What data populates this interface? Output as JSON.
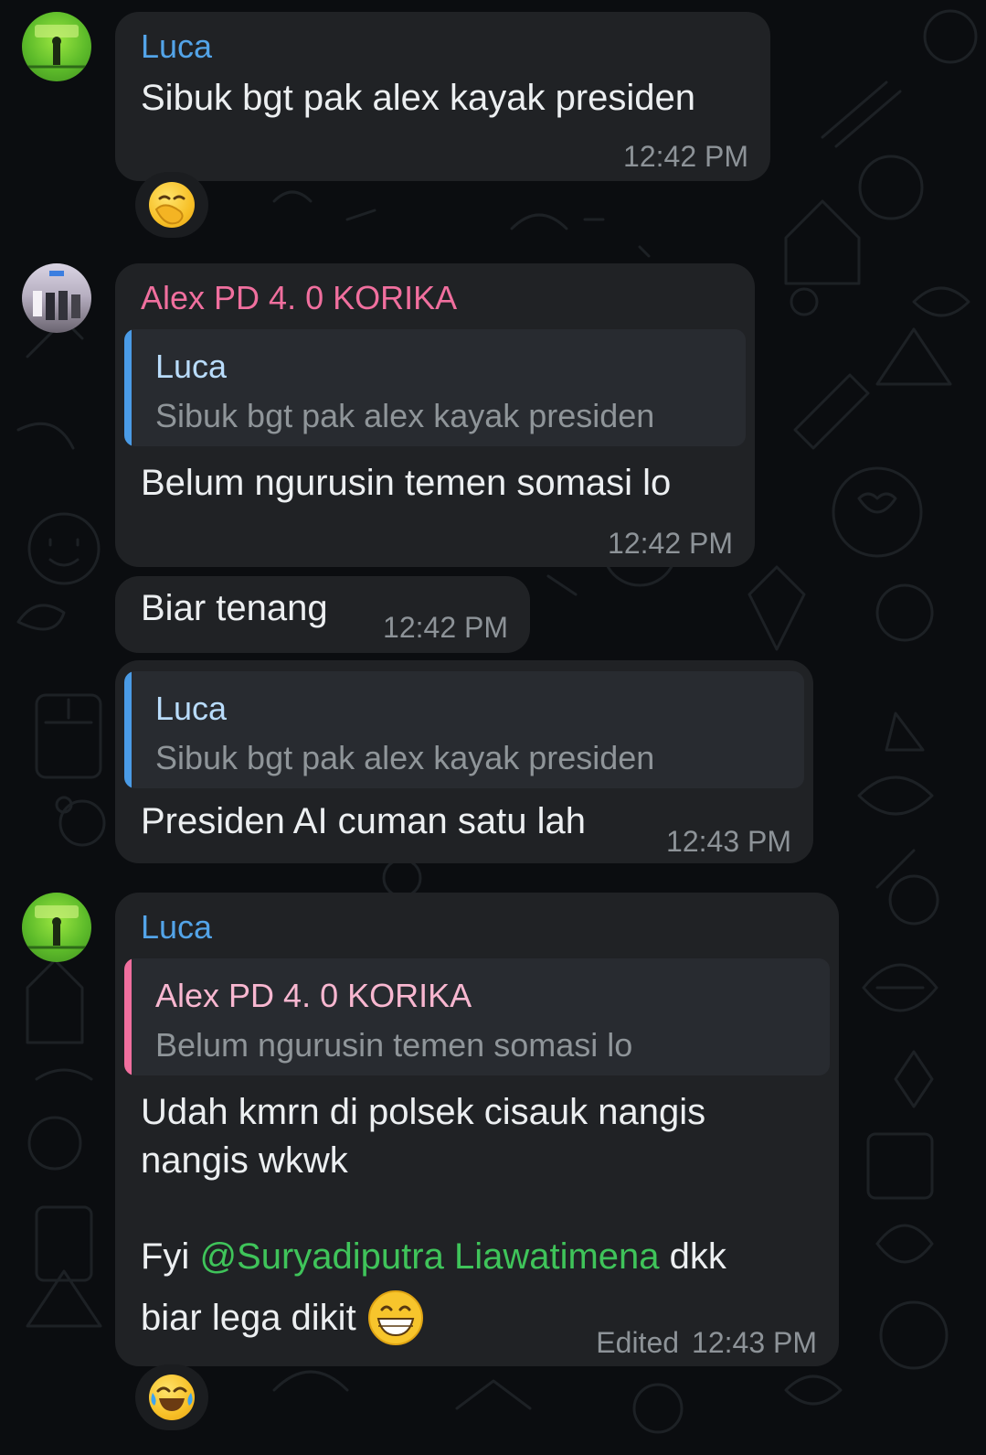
{
  "messages": [
    {
      "sender": "Luca",
      "text": "Sibuk bgt pak alex kayak presiden",
      "time": "12:42 PM",
      "reaction": "face-with-hand-over-mouth-emoji"
    },
    {
      "sender": "Alex PD 4. 0 KORIKA",
      "reply_to": {
        "sender": "Luca",
        "text": "Sibuk bgt pak alex kayak presiden"
      },
      "text": "Belum ngurusin temen somasi lo",
      "time": "12:42 PM"
    },
    {
      "text": "Biar tenang",
      "time": "12:42 PM"
    },
    {
      "reply_to": {
        "sender": "Luca",
        "text": "Sibuk bgt pak alex kayak presiden"
      },
      "text": "Presiden AI cuman satu lah",
      "time": "12:43 PM"
    },
    {
      "sender": "Luca",
      "reply_to": {
        "sender": "Alex PD 4. 0 KORIKA",
        "text": "Belum ngurusin temen somasi lo"
      },
      "text_line1": "Udah kmrn di polsek cisauk nangis",
      "text_line2": "nangis wkwk",
      "text_fyi": "Fyi",
      "mention": "@Suryadiputra Liawatimena",
      "text_after_mention": "dkk",
      "text_line4": "biar lega dikit",
      "inline_emoji": "grinning-face-emoji",
      "edited": "Edited",
      "time": "12:43 PM",
      "reaction": "face-with-tears-of-joy-emoji"
    }
  ],
  "colors": {
    "background": "#0b0d10",
    "bubble": "#202225",
    "quote_bg": "#282b30",
    "luca_name": "#53a4e8",
    "alex_name": "#f06f9e",
    "mention": "#3fc45a",
    "timestamp": "#8d9398"
  }
}
